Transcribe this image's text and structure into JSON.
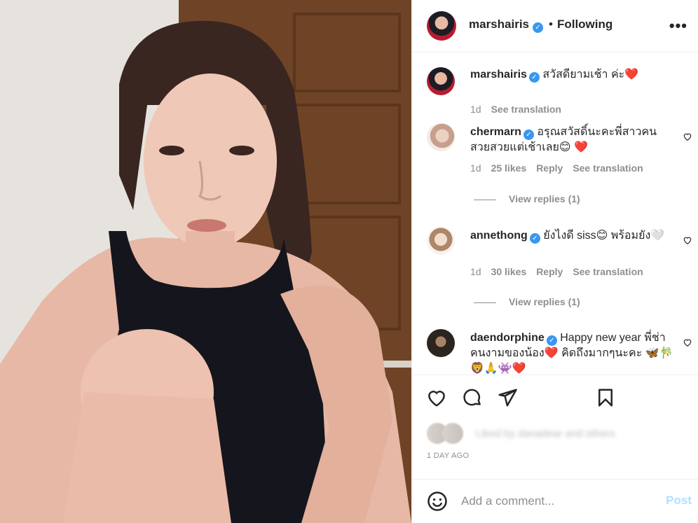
{
  "post": {
    "photo_alt": "",
    "colors": {
      "accent": "#3897f0",
      "heart": "#ed4956",
      "post_disabled": "#b2dffc"
    }
  },
  "header": {
    "username": "marshairis",
    "dot": "•",
    "follow_status": "Following",
    "more_icon": "more-horizontal-icon"
  },
  "caption": {
    "username": "marshairis",
    "text": "สวัสดียามเช้า ค่ะ❤️",
    "time": "1d",
    "see_translation": "See translation"
  },
  "comments": [
    {
      "username": "chermarn",
      "text": "อรุณสวัสดิ์นะคะพี่สาวคนสวยสวยแต่เช้าเลย😊 ❤️",
      "time": "1d",
      "likes": "25 likes",
      "reply": "Reply",
      "see_translation": "See translation",
      "view_replies": "View replies (1)"
    },
    {
      "username": "annethong",
      "text": "ยังไงดี siss😊 พร้อมยัง🤍",
      "time": "1d",
      "likes": "30 likes",
      "reply": "Reply",
      "see_translation": "See translation",
      "view_replies": "View replies (1)"
    },
    {
      "username": "daendorphine",
      "text": "Happy new year พี่ช่าคนงามของน้อง❤️ คิดถึงมากๆนะคะ 🦋🎋🦁🙏👾❤️"
    }
  ],
  "actions": {
    "like_icon": "heart-icon",
    "comment_icon": "comment-icon",
    "share_icon": "share-icon",
    "save_icon": "bookmark-icon",
    "liked_by": "Liked by danadear and others",
    "time_ago": "1 DAY AGO"
  },
  "add_comment": {
    "placeholder": "Add a comment...",
    "post_label": "Post",
    "emoji_icon": "emoji-icon"
  }
}
